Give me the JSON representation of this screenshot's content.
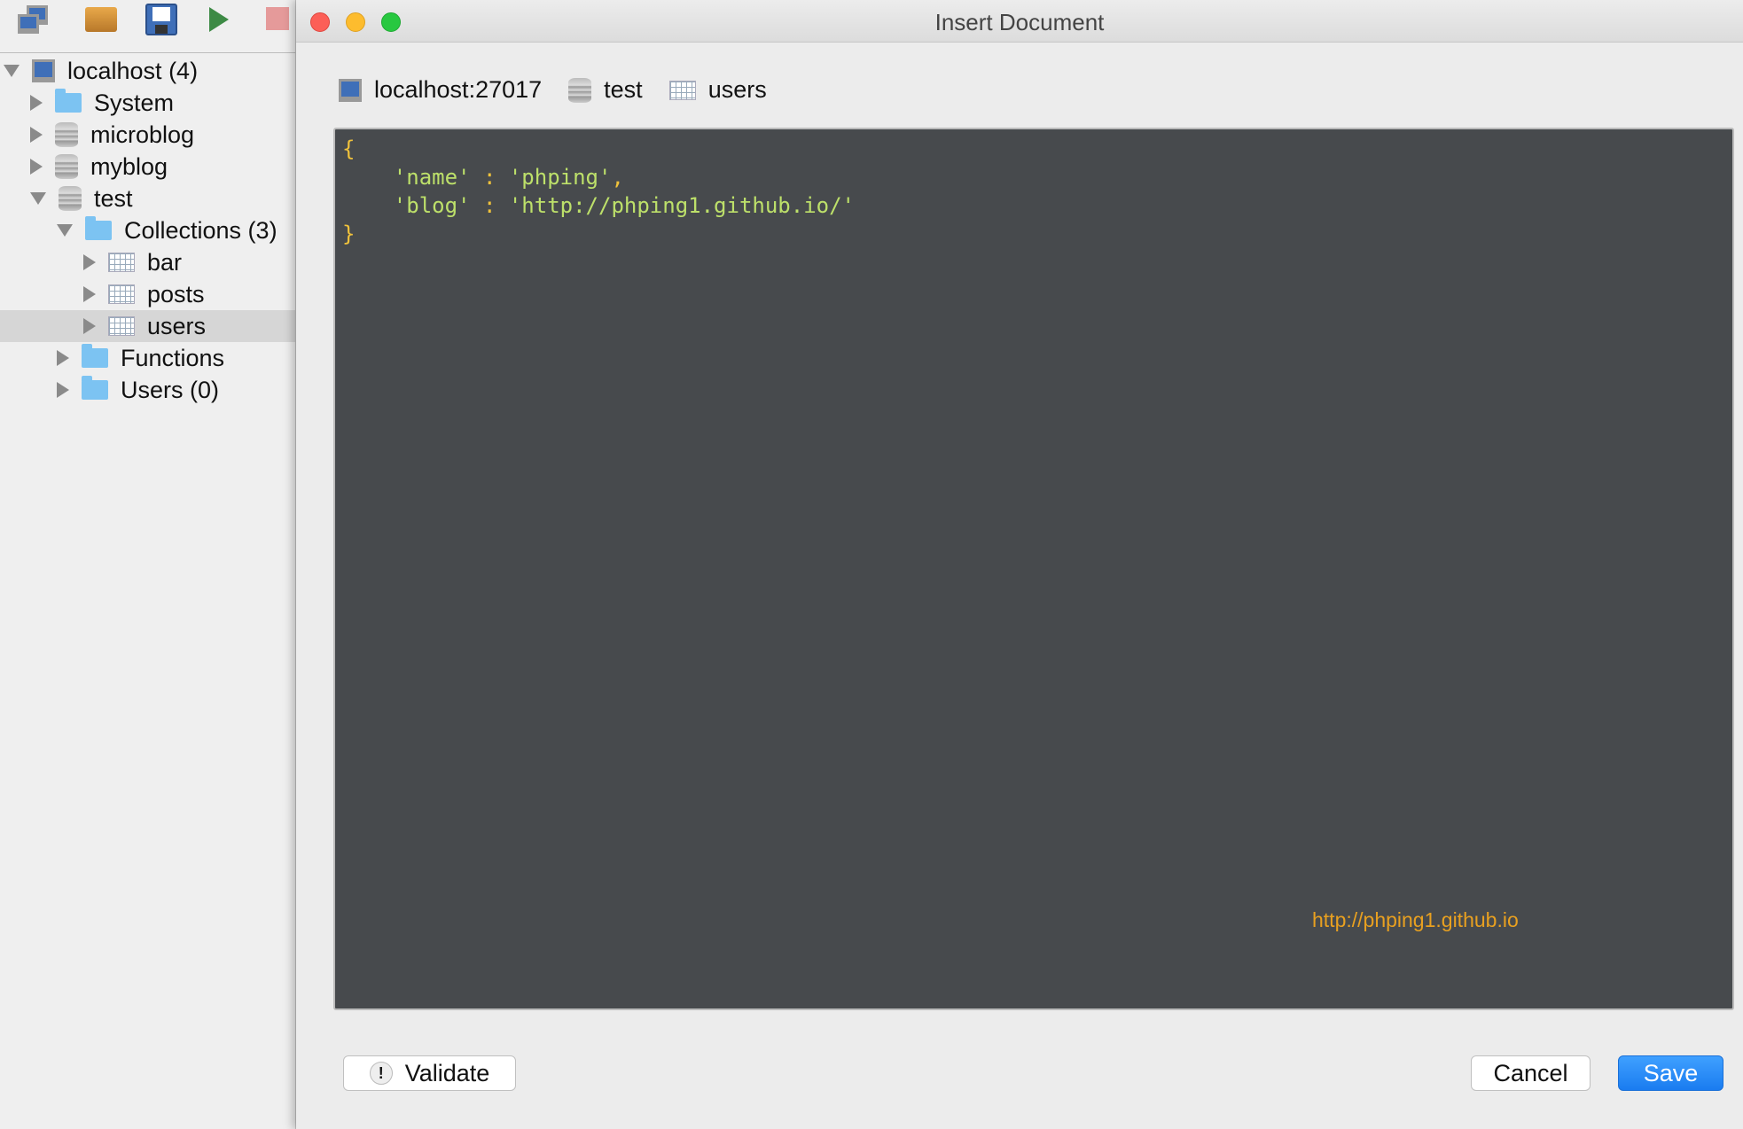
{
  "toolbar": {
    "icons": [
      "connect-icon",
      "open-folder-icon",
      "save-icon",
      "run-icon",
      "stop-icon"
    ]
  },
  "tree": [
    {
      "label": "localhost (4)",
      "icon": "server-icon",
      "level": 0,
      "expanded": true
    },
    {
      "label": "System",
      "icon": "folder-icon",
      "level": 1,
      "expanded": false
    },
    {
      "label": "microblog",
      "icon": "database-icon",
      "level": 1,
      "expanded": false
    },
    {
      "label": "myblog",
      "icon": "database-icon",
      "level": 1,
      "expanded": false
    },
    {
      "label": "test",
      "icon": "database-icon",
      "level": 1,
      "expanded": true
    },
    {
      "label": "Collections (3)",
      "icon": "folder-icon",
      "level": 2,
      "expanded": true
    },
    {
      "label": "bar",
      "icon": "collection-icon",
      "level": 3,
      "expanded": false
    },
    {
      "label": "posts",
      "icon": "collection-icon",
      "level": 3,
      "expanded": false
    },
    {
      "label": "users",
      "icon": "collection-icon",
      "level": 3,
      "expanded": false,
      "selected": true
    },
    {
      "label": "Functions",
      "icon": "folder-icon",
      "level": 2,
      "expanded": false
    },
    {
      "label": "Users (0)",
      "icon": "folder-icon",
      "level": 2,
      "expanded": false
    }
  ],
  "dialog": {
    "title": "Insert Document",
    "breadcrumb": {
      "server": "localhost:27017",
      "database": "test",
      "collection": "users"
    },
    "code": {
      "open": "{",
      "line1_key": "'name'",
      "line1_val": "'phping'",
      "line2_key": "'blog'",
      "line2_val": "'http://phping1.github.io/'",
      "close": "}"
    },
    "watermark": "http://phping1.github.io",
    "validate_label": "Validate",
    "cancel_label": "Cancel",
    "save_label": "Save"
  },
  "colors": {
    "editor_bg": "#474a4d",
    "string": "#bde06a",
    "brace": "#f0c23b",
    "accent": "#1a7cf0"
  }
}
